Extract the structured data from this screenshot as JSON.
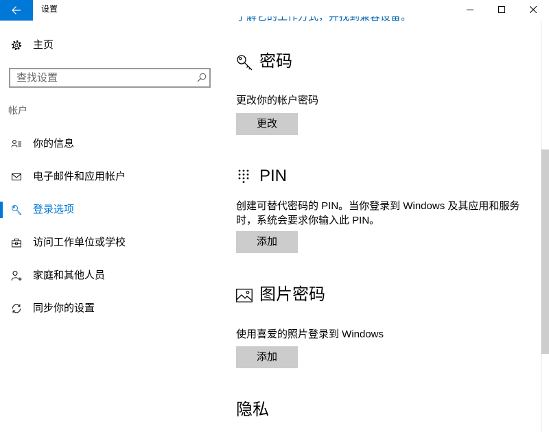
{
  "window": {
    "title": "设置",
    "back_button_icon": "back-arrow-icon",
    "controls": [
      "minimize-icon",
      "maximize-icon",
      "close-icon"
    ]
  },
  "sidebar": {
    "home": {
      "label": "主页",
      "icon": "gear-icon"
    },
    "search": {
      "placeholder": "查找设置",
      "value": "",
      "icon": "search-icon"
    },
    "section_header": "帐户",
    "items": [
      {
        "label": "你的信息",
        "icon": "contact-info-icon",
        "selected": false
      },
      {
        "label": "电子邮件和应用帐户",
        "icon": "mail-icon",
        "selected": false
      },
      {
        "label": "登录选项",
        "icon": "key-icon",
        "selected": true
      },
      {
        "label": "访问工作单位或学校",
        "icon": "briefcase-icon",
        "selected": false
      },
      {
        "label": "家庭和其他人员",
        "icon": "add-person-icon",
        "selected": false
      },
      {
        "label": "同步你的设置",
        "icon": "sync-icon",
        "selected": false
      }
    ]
  },
  "main": {
    "top_link": "了解它的工作方式，并找到兼容设备。",
    "password": {
      "heading": "密码",
      "icon": "key-icon",
      "description": "更改你的帐户密码",
      "button_label": "更改"
    },
    "pin": {
      "heading": "PIN",
      "icon": "keypad-icon",
      "description_lines": [
        "创建可替代密码的 PIN。当你登录到 Windows 及其应用和服务",
        "时，系统会要求你输入此 PIN。"
      ],
      "button_label": "添加"
    },
    "picture_password": {
      "heading": "图片密码",
      "icon": "picture-icon",
      "description": "使用喜爱的照片登录到 Windows",
      "button_label": "添加"
    },
    "privacy": {
      "heading": "隐私"
    }
  },
  "colors": {
    "accent": "#0078d7",
    "button_background": "#cccccc",
    "text": "#000000",
    "secondary_text": "#666666",
    "link": "#0063b1"
  }
}
